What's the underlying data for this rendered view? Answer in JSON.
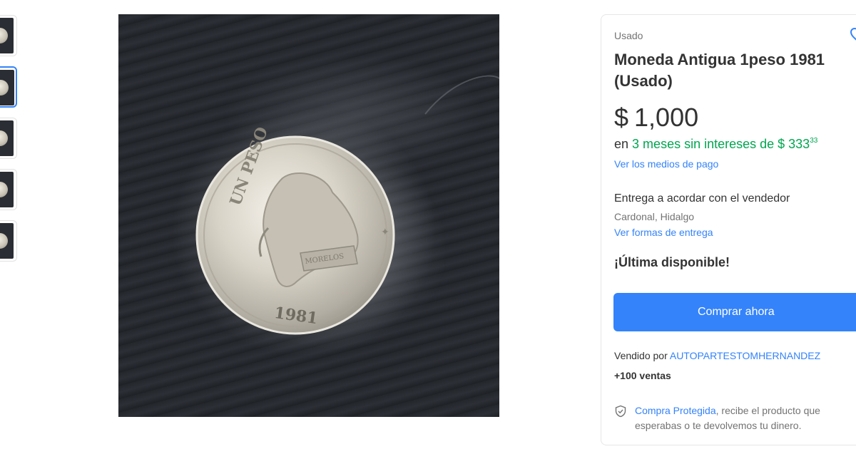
{
  "gallery": {
    "thumbnail_count": 5,
    "active_index": 1,
    "coin_year": "1981"
  },
  "listing": {
    "condition": "Usado",
    "title": "Moneda Antigua 1peso 1981 (Usado)",
    "price_symbol": "$",
    "price": "1,000",
    "installments_prefix": "en",
    "installments_text": "3 meses sin intereses de $ 333",
    "installments_cents": "33",
    "payment_link": "Ver los medios de pago",
    "delivery_title": "Entrega a acordar con el vendedor",
    "location": "Cardonal, Hidalgo",
    "delivery_link": "Ver formas de entrega",
    "stock_note": "¡Última disponible!",
    "buy_button": "Comprar ahora",
    "seller_prefix": "Vendido por",
    "seller_name": "AUTOPARTESTOMHERNANDEZ",
    "sales": "+100 ventas",
    "protected_link": "Compra Protegida",
    "protected_text": ", recibe el producto que esperabas o te devolvemos tu dinero."
  },
  "icons": {
    "favorite": "heart-icon",
    "protection": "shield-check-icon"
  },
  "colors": {
    "accent": "#3483fa",
    "green": "#00a650",
    "muted_text": "#737373"
  }
}
